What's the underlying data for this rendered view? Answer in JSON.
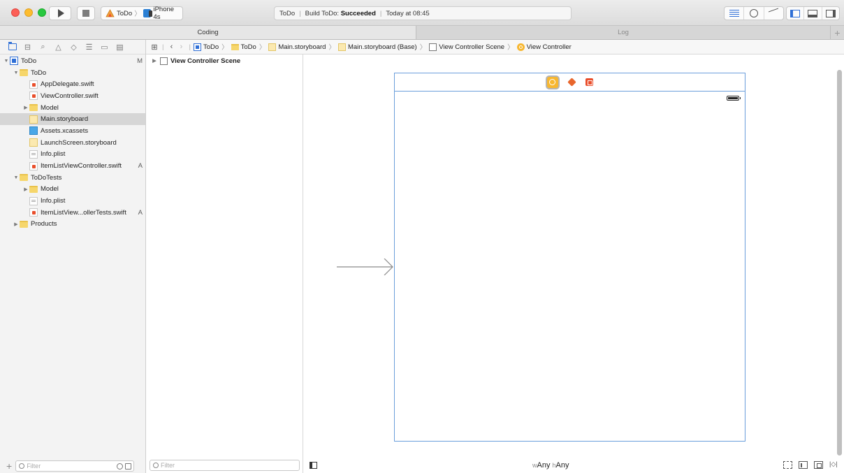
{
  "toolbar": {
    "scheme_target": "ToDo",
    "scheme_device": "iPhone 4s",
    "activity_project": "ToDo",
    "activity_prefix": "Build ToDo:",
    "activity_result": "Succeeded",
    "activity_time": "Today at 08:45"
  },
  "tabs": {
    "coding": "Coding",
    "log": "Log",
    "add": "+"
  },
  "navigator": {
    "items": [
      {
        "label": "ToDo",
        "status": "M"
      },
      {
        "label": "ToDo",
        "status": ""
      },
      {
        "label": "AppDelegate.swift",
        "status": ""
      },
      {
        "label": "ViewController.swift",
        "status": ""
      },
      {
        "label": "Model",
        "status": ""
      },
      {
        "label": "Main.storyboard",
        "status": ""
      },
      {
        "label": "Assets.xcassets",
        "status": ""
      },
      {
        "label": "LaunchScreen.storyboard",
        "status": ""
      },
      {
        "label": "Info.plist",
        "status": ""
      },
      {
        "label": "ItemListViewController.swift",
        "status": "A"
      },
      {
        "label": "ToDoTests",
        "status": ""
      },
      {
        "label": "Model",
        "status": ""
      },
      {
        "label": "Info.plist",
        "status": ""
      },
      {
        "label": "ItemListView...ollerTests.swift",
        "status": "A"
      },
      {
        "label": "Products",
        "status": ""
      }
    ],
    "filter_placeholder": "Filter",
    "add_symbol": "+"
  },
  "jumpbar": {
    "crumbs": [
      "ToDo",
      "ToDo",
      "Main.storyboard",
      "Main.storyboard (Base)",
      "View Controller Scene",
      "View Controller"
    ]
  },
  "outline": {
    "scene_label": "View Controller Scene",
    "filter_placeholder": "Filter"
  },
  "canvas": {
    "size_w_prefix": "w",
    "size_w_value": "Any",
    "size_h_prefix": "h",
    "size_h_value": "Any"
  }
}
